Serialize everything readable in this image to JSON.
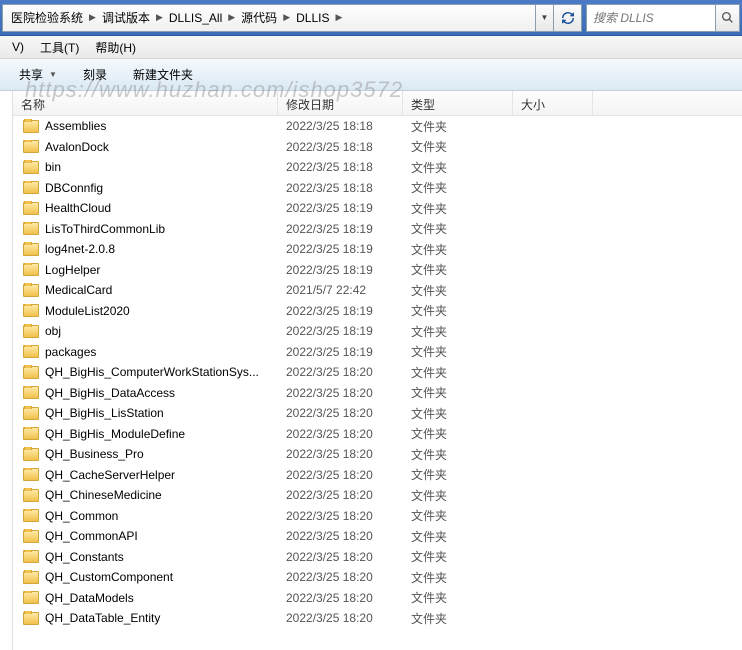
{
  "breadcrumb": {
    "segs": [
      "医院检验系统",
      "调试版本",
      "DLLIS_All",
      "源代码",
      "DLLIS"
    ]
  },
  "search": {
    "placeholder": "搜索 DLLIS"
  },
  "menu": {
    "tools": "工具(T)",
    "help": "帮助(H)",
    "v": "V)"
  },
  "toolbar": {
    "share": "共享",
    "burn": "刻录",
    "newFolder": "新建文件夹"
  },
  "watermark": "https://www.huzhan.com/ishop3572",
  "headers": {
    "name": "名称",
    "date": "修改日期",
    "type": "类型",
    "size": "大小"
  },
  "rows": [
    {
      "name": "Assemblies",
      "date": "2022/3/25 18:18",
      "type": "文件夹"
    },
    {
      "name": "AvalonDock",
      "date": "2022/3/25 18:18",
      "type": "文件夹"
    },
    {
      "name": "bin",
      "date": "2022/3/25 18:18",
      "type": "文件夹"
    },
    {
      "name": "DBConnfig",
      "date": "2022/3/25 18:18",
      "type": "文件夹"
    },
    {
      "name": "HealthCloud",
      "date": "2022/3/25 18:19",
      "type": "文件夹"
    },
    {
      "name": "LisToThirdCommonLib",
      "date": "2022/3/25 18:19",
      "type": "文件夹"
    },
    {
      "name": "log4net-2.0.8",
      "date": "2022/3/25 18:19",
      "type": "文件夹"
    },
    {
      "name": "LogHelper",
      "date": "2022/3/25 18:19",
      "type": "文件夹"
    },
    {
      "name": "MedicalCard",
      "date": "2021/5/7 22:42",
      "type": "文件夹"
    },
    {
      "name": "ModuleList2020",
      "date": "2022/3/25 18:19",
      "type": "文件夹"
    },
    {
      "name": "obj",
      "date": "2022/3/25 18:19",
      "type": "文件夹"
    },
    {
      "name": "packages",
      "date": "2022/3/25 18:19",
      "type": "文件夹"
    },
    {
      "name": "QH_BigHis_ComputerWorkStationSys...",
      "date": "2022/3/25 18:20",
      "type": "文件夹"
    },
    {
      "name": "QH_BigHis_DataAccess",
      "date": "2022/3/25 18:20",
      "type": "文件夹"
    },
    {
      "name": "QH_BigHis_LisStation",
      "date": "2022/3/25 18:20",
      "type": "文件夹"
    },
    {
      "name": "QH_BigHis_ModuleDefine",
      "date": "2022/3/25 18:20",
      "type": "文件夹"
    },
    {
      "name": "QH_Business_Pro",
      "date": "2022/3/25 18:20",
      "type": "文件夹"
    },
    {
      "name": "QH_CacheServerHelper",
      "date": "2022/3/25 18:20",
      "type": "文件夹"
    },
    {
      "name": "QH_ChineseMedicine",
      "date": "2022/3/25 18:20",
      "type": "文件夹"
    },
    {
      "name": "QH_Common",
      "date": "2022/3/25 18:20",
      "type": "文件夹"
    },
    {
      "name": "QH_CommonAPI",
      "date": "2022/3/25 18:20",
      "type": "文件夹"
    },
    {
      "name": "QH_Constants",
      "date": "2022/3/25 18:20",
      "type": "文件夹"
    },
    {
      "name": "QH_CustomComponent",
      "date": "2022/3/25 18:20",
      "type": "文件夹"
    },
    {
      "name": "QH_DataModels",
      "date": "2022/3/25 18:20",
      "type": "文件夹"
    },
    {
      "name": "QH_DataTable_Entity",
      "date": "2022/3/25 18:20",
      "type": "文件夹"
    }
  ]
}
